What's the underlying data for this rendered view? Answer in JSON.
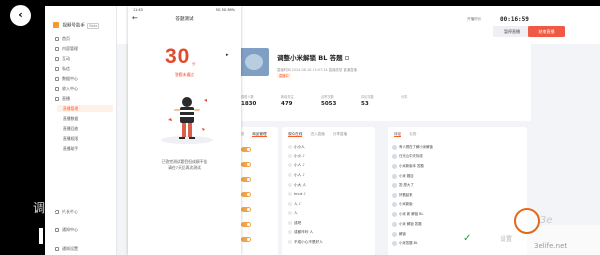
{
  "sidebar": {
    "brand": "视频号助手",
    "brand_tag": "Beta",
    "items": [
      "首页",
      "内容管理",
      "互动",
      "私信",
      "数据中心",
      "收入中心",
      "直播"
    ],
    "live_subitems": [
      "直播管理",
      "直播数据",
      "直播回放",
      "直播权限",
      "直播助手"
    ],
    "lower_items": [
      "成长中心",
      "通知中心",
      "通知设置"
    ]
  },
  "topbar": {
    "hint": "开播时长",
    "timer": "00:16:59",
    "start_label": "暂停直播",
    "end_label": "结束直播"
  },
  "live": {
    "title": "调整小米解锁 BL 答题",
    "meta_left": "直播时间 2024-08-18 15:07:34",
    "meta_right": "直播类型 普通直播",
    "tag": "直播中",
    "stats": [
      {
        "label": "观看人数",
        "value": "1830"
      },
      {
        "label": "新增关注",
        "value": "479"
      },
      {
        "label": "点赞次数",
        "value": "5053"
      },
      {
        "label": "评论次数",
        "value": "53"
      },
      {
        "label": "分享",
        "value": ""
      }
    ]
  },
  "panels": {
    "left_tabs": [
      "推流",
      "商品管理"
    ],
    "middle_tabs": [
      "观众在线",
      "进入直播",
      "分享直播"
    ],
    "middle_rows": [
      "小小人",
      "小小 ♪",
      "小人 ♪",
      "小人 ♪",
      "小大 人",
      "hnut ♪",
      "人 ♪",
      "人",
      "成吧",
      "成都咔咔·人",
      "不成小心不是好人"
    ],
    "right_tabs": [
      "评论",
      "礼物"
    ],
    "right_rows": [
      "有人想在了解小米解锁",
      "日光山中天际线",
      "小米新版本 答题",
      "小米 题目",
      "答:是大了",
      "好看起来",
      "小米新版",
      "小米 新 解锁 BL",
      "小米 解锁 答题",
      "解锁",
      "小米答题 BL"
    ]
  },
  "phone": {
    "time": "11:43",
    "status_right": "5G 5G 89%",
    "title": "答题测试",
    "score": "30",
    "score_unit": "分",
    "score_sub": "答题未通过",
    "desc_line1": "已答完测试题目但成绩不佳",
    "desc_line2": "请在7天后再次测试"
  },
  "overlay": {
    "caption": "调整小米解锁",
    "watermark": "3e",
    "watermark_url": "3elife.net",
    "fog_text": "设置"
  }
}
